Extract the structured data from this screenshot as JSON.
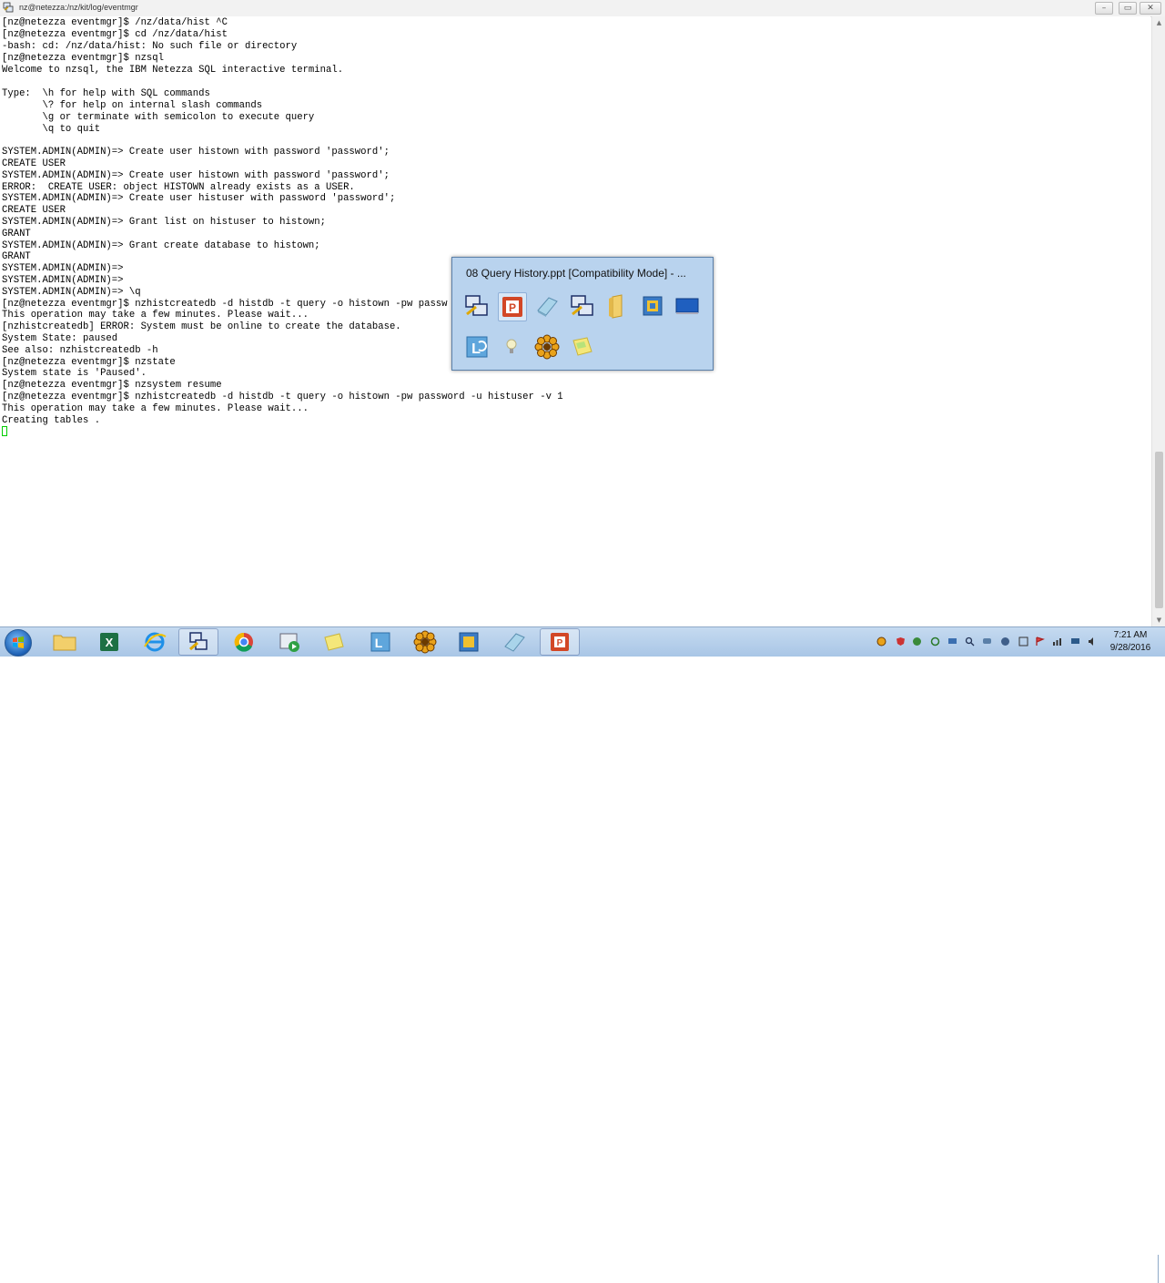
{
  "window": {
    "title": "nz@netezza:/nz/kit/log/eventmgr",
    "minimize_glyph": "–",
    "maximize_glyph": "▭",
    "close_glyph": "✕"
  },
  "terminal": {
    "lines": [
      "[nz@netezza eventmgr]$ /nz/data/hist ^C",
      "[nz@netezza eventmgr]$ cd /nz/data/hist",
      "-bash: cd: /nz/data/hist: No such file or directory",
      "[nz@netezza eventmgr]$ nzsql",
      "Welcome to nzsql, the IBM Netezza SQL interactive terminal.",
      "",
      "Type:  \\h for help with SQL commands",
      "       \\? for help on internal slash commands",
      "       \\g or terminate with semicolon to execute query",
      "       \\q to quit",
      "",
      "SYSTEM.ADMIN(ADMIN)=> Create user histown with password 'password';",
      "CREATE USER",
      "SYSTEM.ADMIN(ADMIN)=> Create user histown with password 'password';",
      "ERROR:  CREATE USER: object HISTOWN already exists as a USER.",
      "SYSTEM.ADMIN(ADMIN)=> Create user histuser with password 'password';",
      "CREATE USER",
      "SYSTEM.ADMIN(ADMIN)=> Grant list on histuser to histown;",
      "GRANT",
      "SYSTEM.ADMIN(ADMIN)=> Grant create database to histown;",
      "GRANT",
      "SYSTEM.ADMIN(ADMIN)=>",
      "SYSTEM.ADMIN(ADMIN)=>",
      "SYSTEM.ADMIN(ADMIN)=> \\q",
      "[nz@netezza eventmgr]$ nzhistcreatedb -d histdb -t query -o histown -pw passw",
      "This operation may take a few minutes. Please wait...",
      "[nzhistcreatedb] ERROR: System must be online to create the database.",
      "System State: paused",
      "See also: nzhistcreatedb -h",
      "[nz@netezza eventmgr]$ nzstate",
      "System state is 'Paused'.",
      "[nz@netezza eventmgr]$ nzsystem resume",
      "[nz@netezza eventmgr]$ nzhistcreatedb -d histdb -t query -o histown -pw password -u histuser -v 1",
      "This operation may take a few minutes. Please wait...",
      "Creating tables ."
    ]
  },
  "popup": {
    "title": "08 Query History.ppt [Compatibility Mode] - ...",
    "icons": [
      "putty-icon",
      "powerpoint-icon",
      "eraser-app-icon",
      "putty-icon",
      "folder-icon",
      "virtualbox-icon",
      "monitor-icon",
      "lync-icon",
      "lightbulb-icon",
      "flower-app-icon",
      "notes-icon"
    ]
  },
  "taskbar": {
    "buttons": [
      "folder-icon",
      "excel-icon",
      "ie-icon",
      "putty-icon",
      "chrome-icon",
      "media-icon",
      "notes-icon",
      "lync-icon",
      "flower-app-icon",
      "virtualbox-icon",
      "eraser-app-icon",
      "powerpoint-icon"
    ],
    "clock_time": "7:21 AM",
    "clock_date": "9/28/2016"
  },
  "colors": {
    "popup_bg": "#b9d3ee",
    "taskbar": "#b3cde8",
    "cursor": "#00cc00"
  }
}
